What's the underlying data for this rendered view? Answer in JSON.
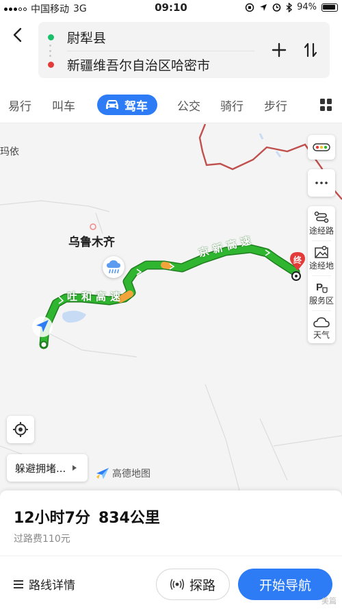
{
  "status_bar": {
    "carrier": "中国移动",
    "network": "3G",
    "time": "09:10",
    "battery": "94%"
  },
  "header": {
    "from": "尉犁县",
    "to": "新疆维吾尔自治区哈密市",
    "add_icon": "plus-icon",
    "swap_icon": "swap-icon"
  },
  "tabs": [
    {
      "label": "易行",
      "active": false
    },
    {
      "label": "叫车",
      "active": false
    },
    {
      "label": "驾车",
      "active": true,
      "icon": "car-icon"
    },
    {
      "label": "公交",
      "active": false
    },
    {
      "label": "骑行",
      "active": false
    },
    {
      "label": "步行",
      "active": false
    }
  ],
  "map": {
    "labels": {
      "mayi": "玛依",
      "urumqi": "乌鲁木齐"
    },
    "road_1": "吐和高速",
    "road_2": "京新高速",
    "end_marker": "终",
    "controls": {
      "waypoint": "途经路",
      "via": "途经地",
      "service": "服务区",
      "weather": "天气"
    },
    "avoid_button": "躲避拥堵...",
    "logo_text": "高德地图",
    "colors": {
      "route": "#2fb52f",
      "route_outline": "#1f7d1f",
      "border": "#c0504d",
      "accent": "#2d7cf6"
    }
  },
  "summary": {
    "duration": "12小时7分",
    "distance": "834公里",
    "toll": "过路费110元"
  },
  "actions": {
    "details": "路线详情",
    "probe": "探路",
    "start": "开始导航"
  },
  "watermark": "美篇"
}
